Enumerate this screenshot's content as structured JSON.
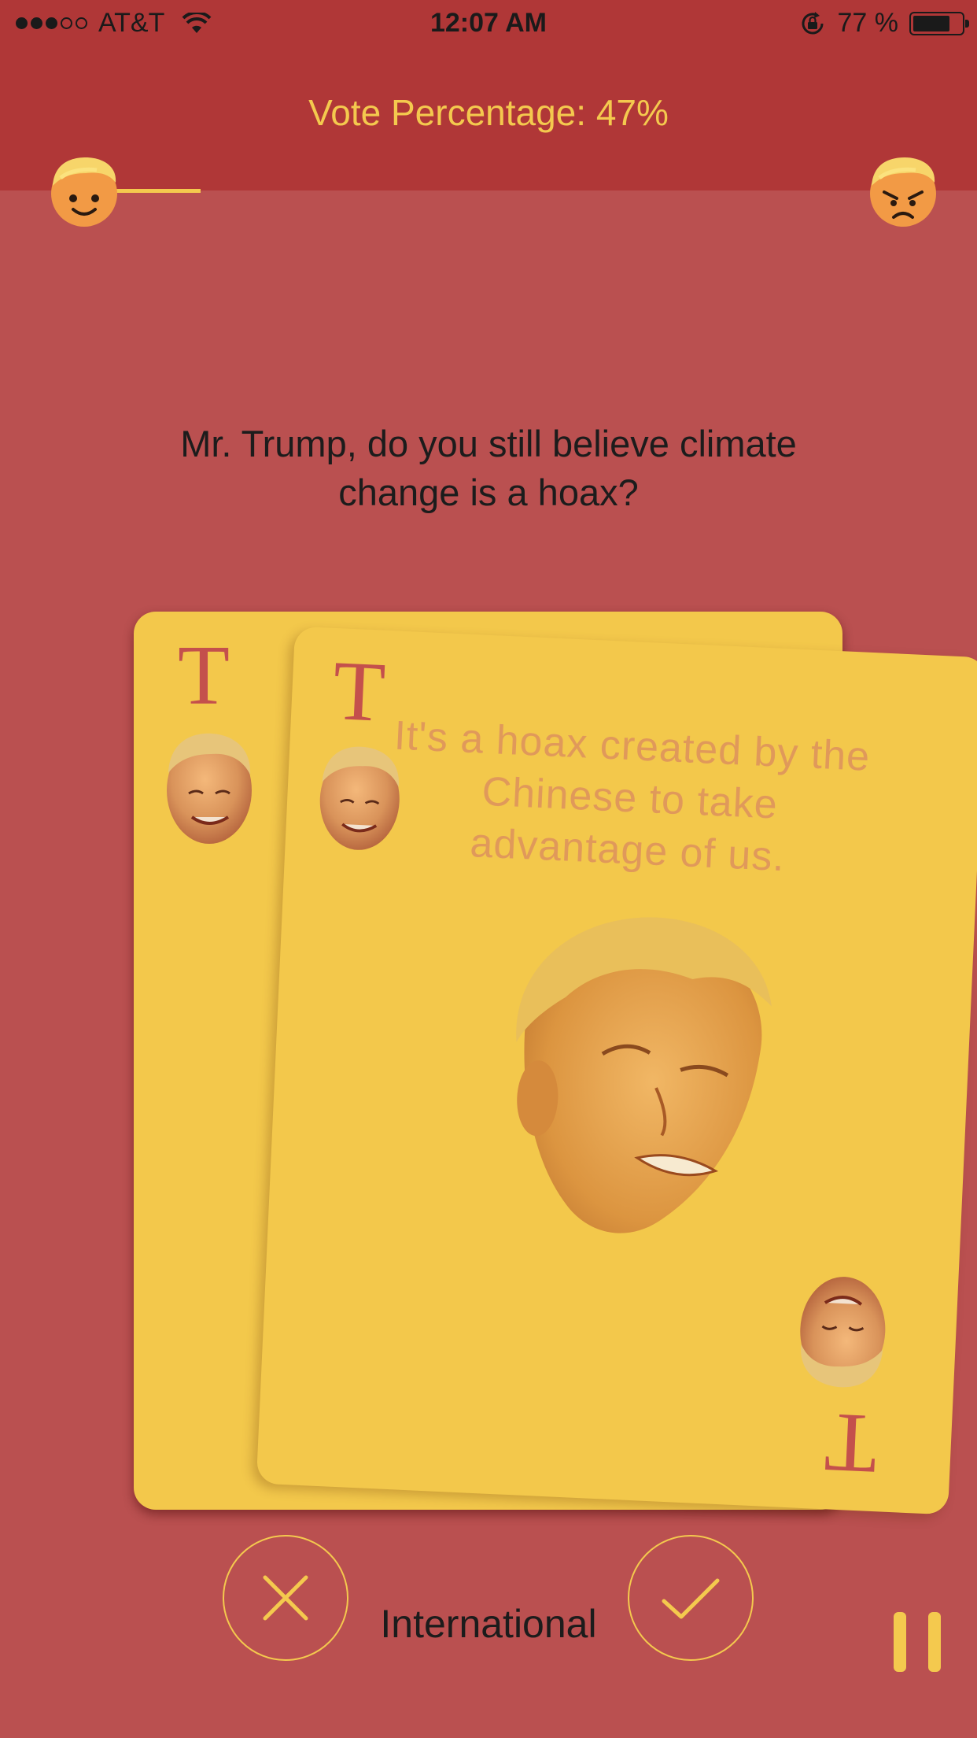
{
  "status_bar": {
    "carrier": "AT&T",
    "time": "12:07 AM",
    "battery_percent": "77 %",
    "battery_level": 0.77,
    "signal_bars_filled": 3,
    "signal_bars_total": 5
  },
  "header": {
    "title": "Vote Percentage: 47%",
    "left_icon": "happy-face-icon",
    "right_icon": "angry-face-icon"
  },
  "question": "Mr. Trump, do you still believe climate change is a hoax?",
  "cards": {
    "corner_letter": "T",
    "answer": "It's a hoax created by the Chinese to take advantage of us."
  },
  "controls": {
    "reject_icon": "close-icon",
    "accept_icon": "checkmark-icon",
    "category": "International",
    "pause_icon": "pause-icon"
  },
  "colors": {
    "header_bg": "#b03737",
    "page_bg": "#ba5050",
    "accent": "#f4c94e",
    "card": "#f3c84b",
    "card_letter": "#c4504c",
    "answer_text": "#e0995a"
  }
}
